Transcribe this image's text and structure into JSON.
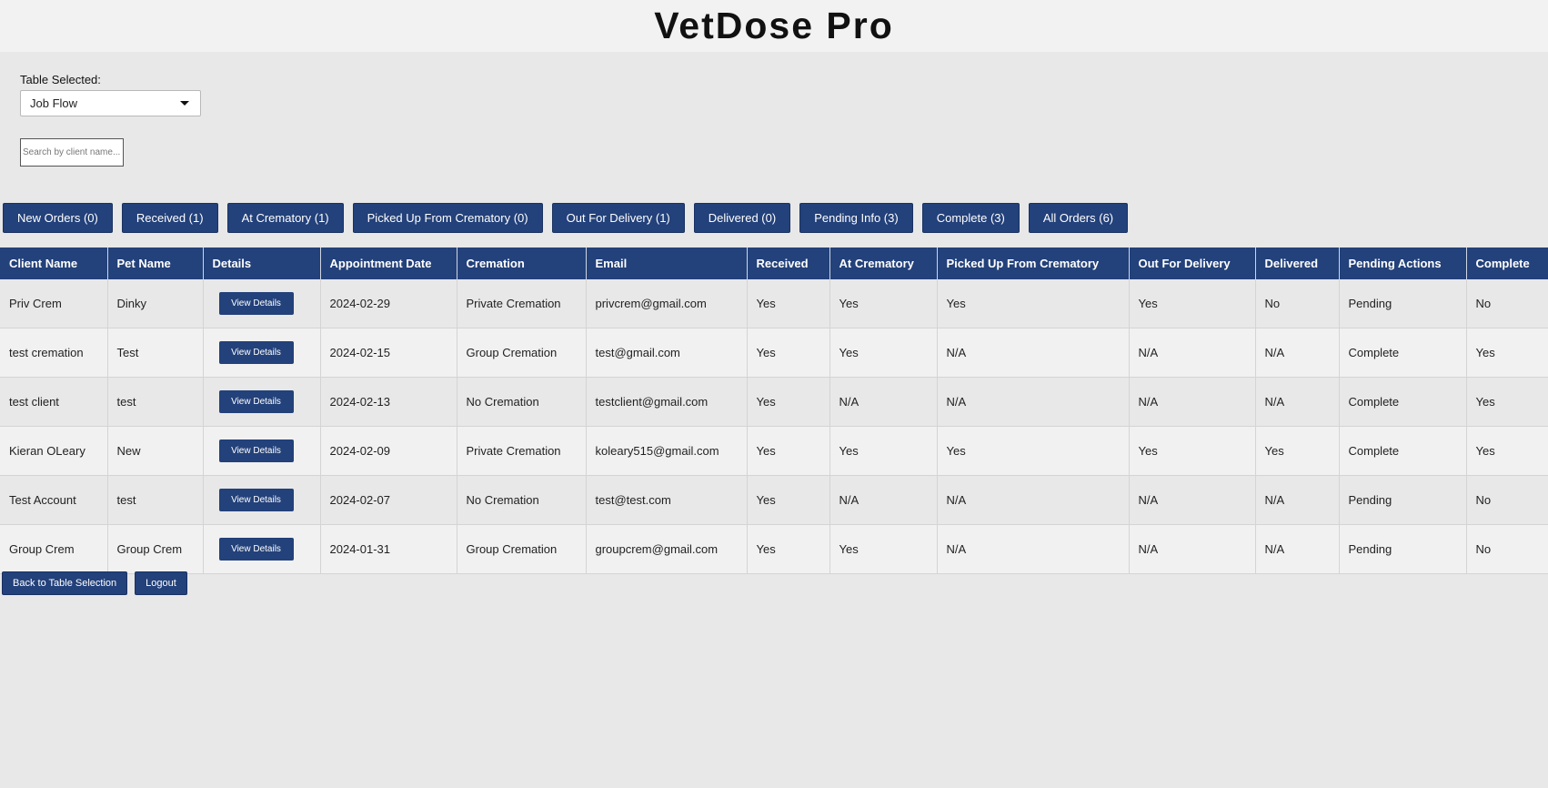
{
  "app": {
    "title": "VetDose Pro"
  },
  "controls": {
    "table_label": "Table Selected:",
    "table_selected": "Job Flow",
    "search_placeholder": "Search by client name..."
  },
  "tabs": [
    {
      "label": "New Orders (0)"
    },
    {
      "label": "Received (1)"
    },
    {
      "label": "At Crematory (1)"
    },
    {
      "label": "Picked Up From Crematory (0)"
    },
    {
      "label": "Out For Delivery (1)"
    },
    {
      "label": "Delivered (0)"
    },
    {
      "label": "Pending Info (3)"
    },
    {
      "label": "Complete (3)"
    },
    {
      "label": "All Orders (6)"
    }
  ],
  "table": {
    "headers": [
      "Client Name",
      "Pet Name",
      "Details",
      "Appointment Date",
      "Cremation",
      "Email",
      "Received",
      "At Crematory",
      "Picked Up From Crematory",
      "Out For Delivery",
      "Delivered",
      "Pending Actions",
      "Complete"
    ],
    "details_button_label": "View Details",
    "rows": [
      [
        "Priv Crem",
        "Dinky",
        "2024-02-29",
        "Private Cremation",
        "privcrem@gmail.com",
        "Yes",
        "Yes",
        "Yes",
        "Yes",
        "No",
        "Pending",
        "No"
      ],
      [
        "test cremation",
        "Test",
        "2024-02-15",
        "Group Cremation",
        "test@gmail.com",
        "Yes",
        "Yes",
        "N/A",
        "N/A",
        "N/A",
        "Complete",
        "Yes"
      ],
      [
        "test client",
        "test",
        "2024-02-13",
        "No Cremation",
        "testclient@gmail.com",
        "Yes",
        "N/A",
        "N/A",
        "N/A",
        "N/A",
        "Complete",
        "Yes"
      ],
      [
        "Kieran OLeary",
        "New",
        "2024-02-09",
        "Private Cremation",
        "koleary515@gmail.com",
        "Yes",
        "Yes",
        "Yes",
        "Yes",
        "Yes",
        "Complete",
        "Yes"
      ],
      [
        "Test Account",
        "test",
        "2024-02-07",
        "No Cremation",
        "test@test.com",
        "Yes",
        "N/A",
        "N/A",
        "N/A",
        "N/A",
        "Pending",
        "No"
      ],
      [
        "Group Crem",
        "Group Crem",
        "2024-01-31",
        "Group Cremation",
        "groupcrem@gmail.com",
        "Yes",
        "Yes",
        "N/A",
        "N/A",
        "N/A",
        "Pending",
        "No"
      ]
    ]
  },
  "footer": {
    "back_label": "Back to Table Selection",
    "logout_label": "Logout"
  },
  "colors": {
    "primary": "#23417a",
    "background": "#e8e8e8",
    "header_bg": "#f2f2f2"
  }
}
